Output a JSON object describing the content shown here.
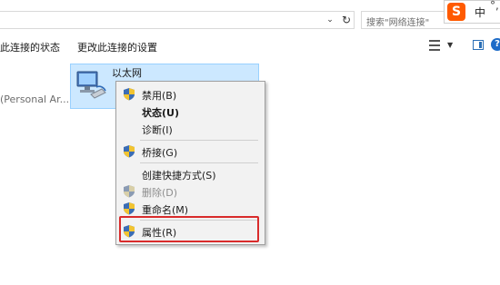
{
  "address_bar": {
    "search_placeholder": "搜索\"网络连接\"",
    "dropdown_icon": "chevron-down-icon",
    "refresh_icon": "refresh-icon"
  },
  "ime": {
    "logo": "S",
    "lang": "中",
    "extra": "°,"
  },
  "toolbar": {
    "item1": "此连接的状态",
    "item2": "更改此连接的设置"
  },
  "content": {
    "connection_name": "以太网",
    "left_text": "(Personal Ar..."
  },
  "context_menu": {
    "disable": "禁用(B)",
    "status": "状态(U)",
    "diagnose": "诊断(I)",
    "bridge": "桥接(G)",
    "create_shortcut": "创建快捷方式(S)",
    "delete": "删除(D)",
    "rename": "重命名(M)",
    "properties": "属性(R)"
  },
  "colors": {
    "selection": "#cce8ff",
    "highlight_border": "#d92b2b",
    "menu_bg": "#f2f2f2"
  }
}
